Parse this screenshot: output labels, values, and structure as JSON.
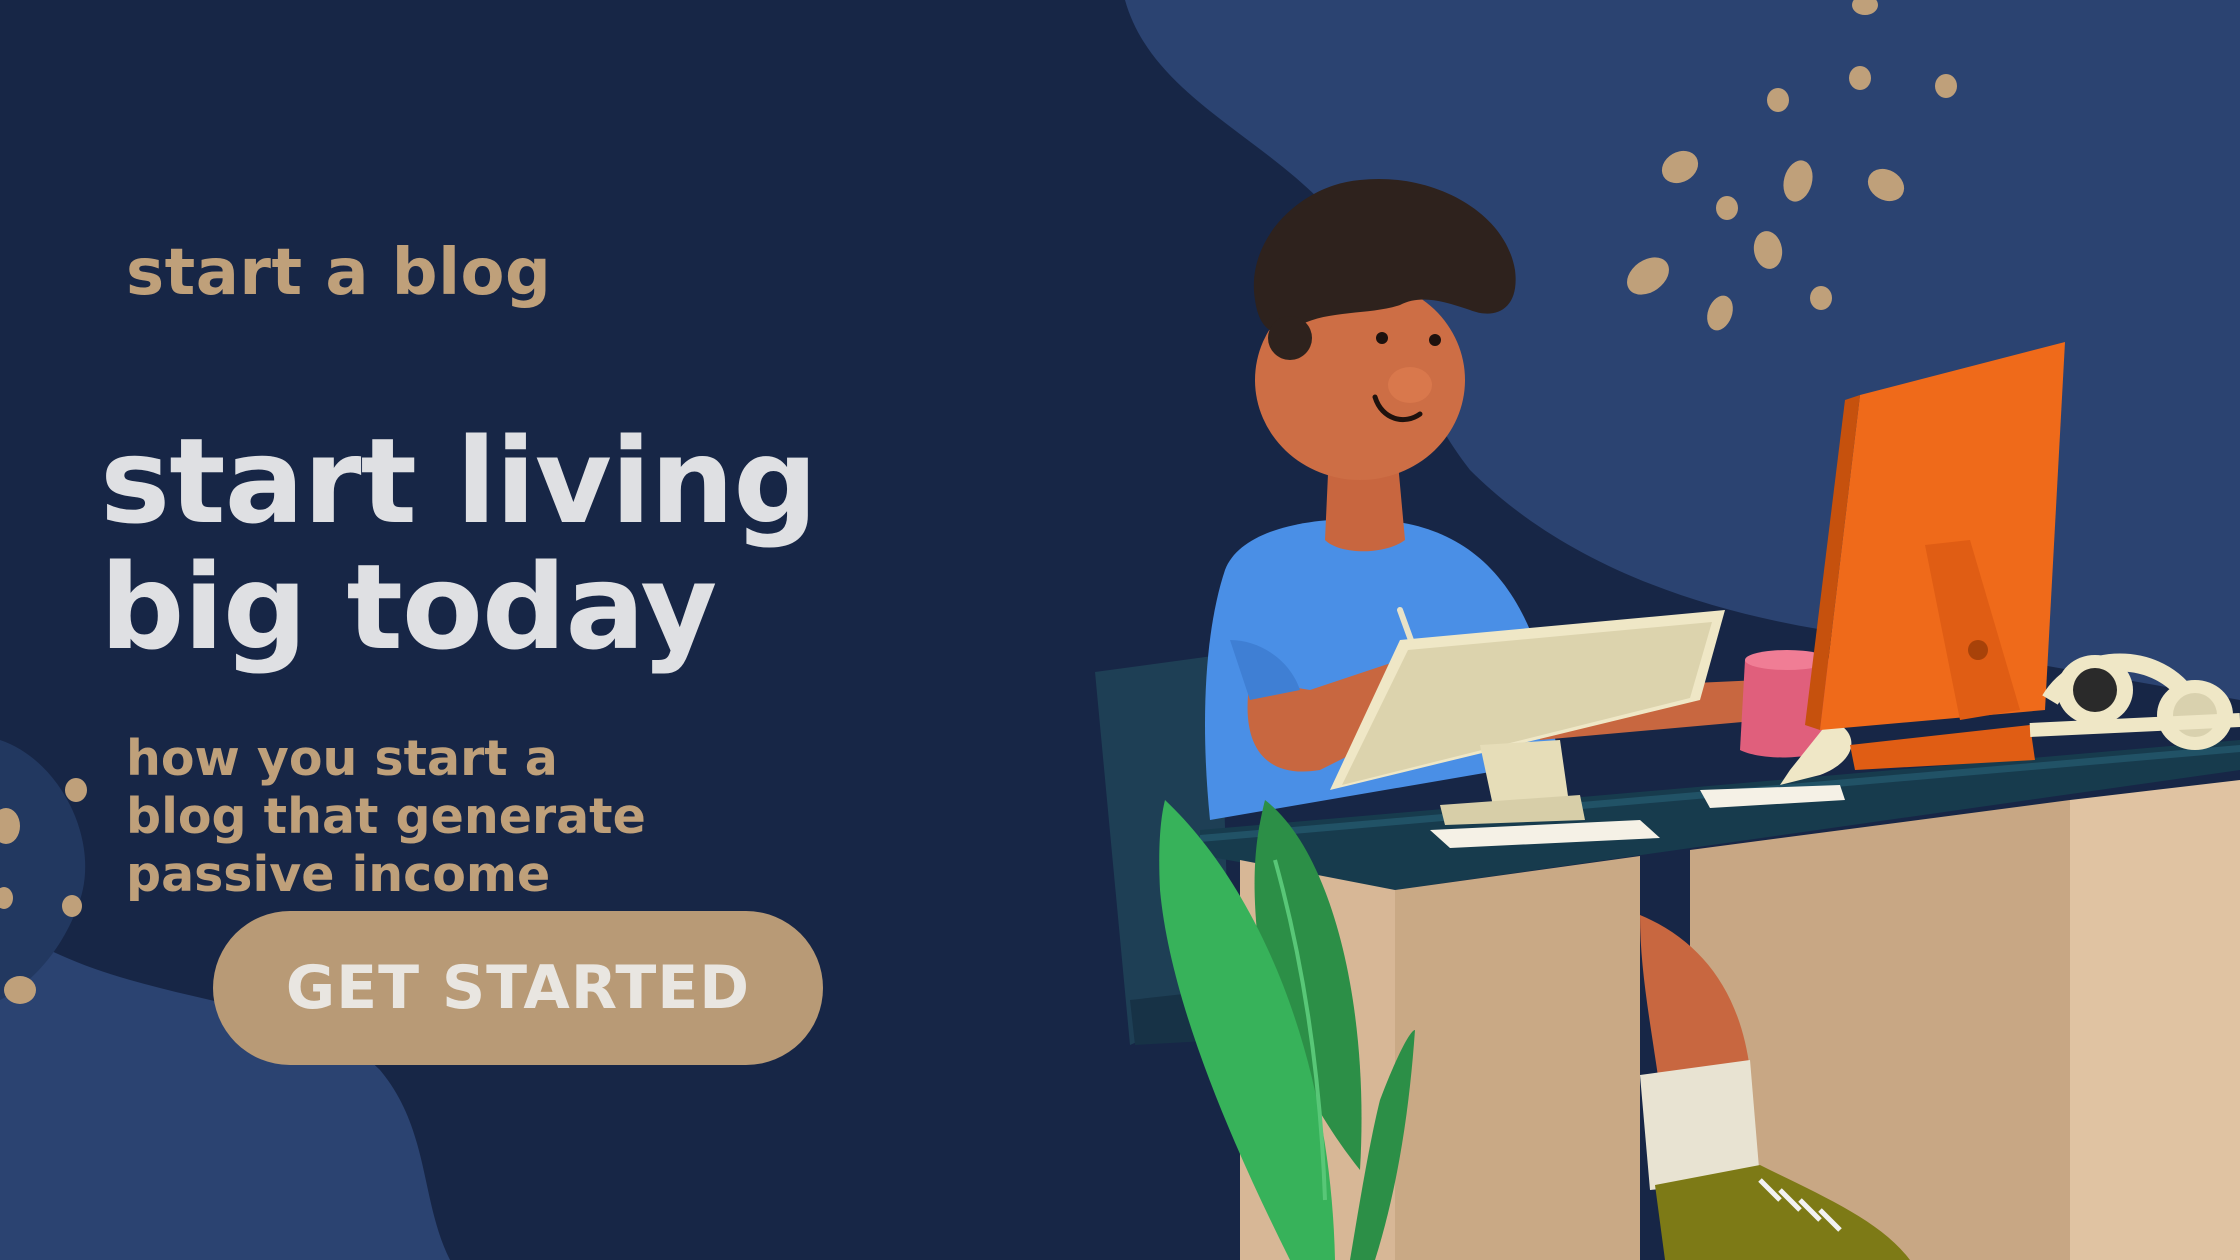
{
  "hero": {
    "eyebrow": "start a blog",
    "headline_line1": "start living",
    "headline_line2": "big today",
    "subtext_line1": "how you start a",
    "subtext_line2": "blog that generate",
    "subtext_line3": "passive income",
    "cta_label": "GET STARTED"
  },
  "colors": {
    "background_dark": "#172646",
    "background_blob": "#2b4371",
    "accent_tan": "#bfa07a",
    "headline": "#dfe0e3",
    "monitor_orange": "#ef6a1a",
    "shirt_blue": "#4a8fe6",
    "desk_top": "#173b4d",
    "plant_green": "#37b25a"
  },
  "illustration": {
    "subject": "person working at desk with computers",
    "icons": [
      "person-figure",
      "desktop-monitor-icon",
      "laptop-icon",
      "mug-icon",
      "headphones-icon",
      "plant-icon",
      "desk-icon",
      "chair-icon"
    ]
  }
}
